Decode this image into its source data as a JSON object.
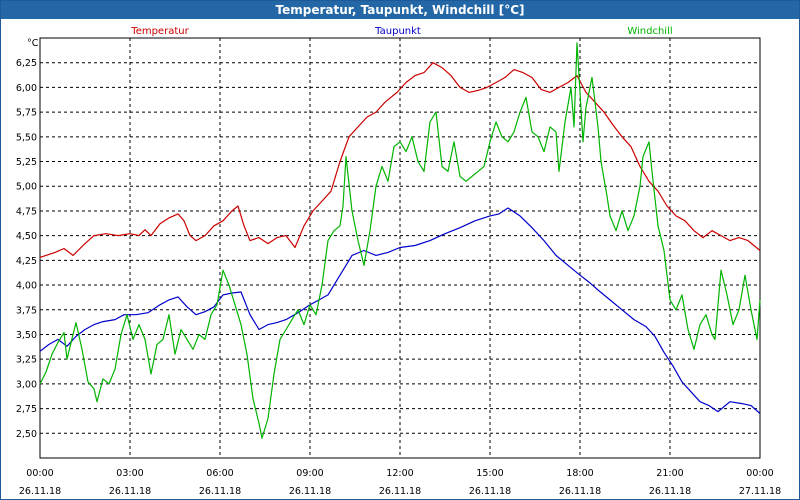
{
  "window": {
    "title": "Temperatur, Taupunkt, Windchill [°C]"
  },
  "chart_data": {
    "type": "line",
    "title": "Temperatur, Taupunkt, Windchill [°C]",
    "ylabel": "°C",
    "xlabel": "",
    "ylim": [
      2.25,
      6.5
    ],
    "xlim": [
      0,
      24
    ],
    "grid": true,
    "legend_position": "top",
    "y_ticks": [
      "2,50",
      "2,75",
      "3,00",
      "3,25",
      "3,50",
      "3,75",
      "4,00",
      "4,25",
      "4,50",
      "4,75",
      "5,00",
      "5,25",
      "5,50",
      "5,75",
      "6,00",
      "6,25"
    ],
    "y_tick_values": [
      2.5,
      2.75,
      3.0,
      3.25,
      3.5,
      3.75,
      4.0,
      4.25,
      4.5,
      4.75,
      5.0,
      5.25,
      5.5,
      5.75,
      6.0,
      6.25
    ],
    "x_tick_values": [
      0,
      3,
      6,
      9,
      12,
      15,
      18,
      21,
      24
    ],
    "x_ticks": [
      {
        "time": "00:00",
        "date": "26.11.18"
      },
      {
        "time": "03:00",
        "date": "26.11.18"
      },
      {
        "time": "06:00",
        "date": "26.11.18"
      },
      {
        "time": "09:00",
        "date": "26.11.18"
      },
      {
        "time": "12:00",
        "date": "26.11.18"
      },
      {
        "time": "15:00",
        "date": "26.11.18"
      },
      {
        "time": "18:00",
        "date": "26.11.18"
      },
      {
        "time": "21:00",
        "date": "26.11.18"
      },
      {
        "time": "00:00",
        "date": "27.11.18"
      }
    ],
    "series": [
      {
        "name": "Temperatur",
        "color": "#cc0000",
        "points": [
          [
            0,
            4.28
          ],
          [
            0.5,
            4.33
          ],
          [
            0.8,
            4.37
          ],
          [
            1.1,
            4.3
          ],
          [
            1.5,
            4.42
          ],
          [
            1.8,
            4.5
          ],
          [
            2.2,
            4.52
          ],
          [
            2.6,
            4.5
          ],
          [
            3.0,
            4.52
          ],
          [
            3.3,
            4.5
          ],
          [
            3.5,
            4.56
          ],
          [
            3.7,
            4.5
          ],
          [
            4.0,
            4.62
          ],
          [
            4.3,
            4.68
          ],
          [
            4.6,
            4.72
          ],
          [
            4.8,
            4.65
          ],
          [
            5.0,
            4.5
          ],
          [
            5.2,
            4.45
          ],
          [
            5.5,
            4.5
          ],
          [
            5.8,
            4.6
          ],
          [
            6.1,
            4.65
          ],
          [
            6.4,
            4.75
          ],
          [
            6.6,
            4.8
          ],
          [
            6.8,
            4.6
          ],
          [
            7.0,
            4.45
          ],
          [
            7.3,
            4.48
          ],
          [
            7.6,
            4.42
          ],
          [
            7.9,
            4.48
          ],
          [
            8.2,
            4.5
          ],
          [
            8.5,
            4.38
          ],
          [
            8.8,
            4.6
          ],
          [
            9.1,
            4.75
          ],
          [
            9.4,
            4.85
          ],
          [
            9.7,
            4.95
          ],
          [
            10.0,
            5.25
          ],
          [
            10.3,
            5.5
          ],
          [
            10.6,
            5.6
          ],
          [
            10.9,
            5.7
          ],
          [
            11.2,
            5.75
          ],
          [
            11.5,
            5.85
          ],
          [
            11.9,
            5.95
          ],
          [
            12.2,
            6.05
          ],
          [
            12.5,
            6.12
          ],
          [
            12.8,
            6.15
          ],
          [
            13.1,
            6.25
          ],
          [
            13.4,
            6.2
          ],
          [
            13.7,
            6.12
          ],
          [
            14.0,
            6.0
          ],
          [
            14.3,
            5.95
          ],
          [
            14.6,
            5.97
          ],
          [
            14.9,
            6.0
          ],
          [
            15.2,
            6.05
          ],
          [
            15.5,
            6.1
          ],
          [
            15.8,
            6.18
          ],
          [
            16.1,
            6.15
          ],
          [
            16.4,
            6.1
          ],
          [
            16.7,
            5.98
          ],
          [
            17.0,
            5.95
          ],
          [
            17.3,
            6.0
          ],
          [
            17.6,
            6.05
          ],
          [
            17.9,
            6.12
          ],
          [
            18.2,
            5.95
          ],
          [
            18.5,
            5.85
          ],
          [
            18.8,
            5.75
          ],
          [
            19.1,
            5.62
          ],
          [
            19.4,
            5.5
          ],
          [
            19.7,
            5.4
          ],
          [
            20.0,
            5.2
          ],
          [
            20.3,
            5.05
          ],
          [
            20.6,
            4.95
          ],
          [
            20.9,
            4.8
          ],
          [
            21.2,
            4.7
          ],
          [
            21.5,
            4.65
          ],
          [
            21.8,
            4.55
          ],
          [
            22.1,
            4.48
          ],
          [
            22.4,
            4.55
          ],
          [
            22.7,
            4.5
          ],
          [
            23.0,
            4.45
          ],
          [
            23.3,
            4.48
          ],
          [
            23.6,
            4.45
          ],
          [
            24.0,
            4.35
          ]
        ]
      },
      {
        "name": "Taupunkt",
        "color": "#0000cc",
        "points": [
          [
            0,
            3.33
          ],
          [
            0.3,
            3.4
          ],
          [
            0.6,
            3.45
          ],
          [
            0.9,
            3.38
          ],
          [
            1.2,
            3.48
          ],
          [
            1.5,
            3.55
          ],
          [
            1.8,
            3.6
          ],
          [
            2.1,
            3.63
          ],
          [
            2.5,
            3.65
          ],
          [
            2.8,
            3.7
          ],
          [
            3.2,
            3.7
          ],
          [
            3.6,
            3.72
          ],
          [
            4.0,
            3.8
          ],
          [
            4.3,
            3.85
          ],
          [
            4.6,
            3.88
          ],
          [
            4.9,
            3.78
          ],
          [
            5.2,
            3.7
          ],
          [
            5.5,
            3.73
          ],
          [
            5.8,
            3.78
          ],
          [
            6.1,
            3.9
          ],
          [
            6.4,
            3.92
          ],
          [
            6.7,
            3.93
          ],
          [
            7.0,
            3.7
          ],
          [
            7.3,
            3.55
          ],
          [
            7.6,
            3.6
          ],
          [
            7.9,
            3.62
          ],
          [
            8.2,
            3.65
          ],
          [
            8.6,
            3.72
          ],
          [
            9.0,
            3.8
          ],
          [
            9.3,
            3.85
          ],
          [
            9.6,
            3.9
          ],
          [
            10.0,
            4.1
          ],
          [
            10.4,
            4.3
          ],
          [
            10.8,
            4.35
          ],
          [
            11.2,
            4.3
          ],
          [
            11.6,
            4.33
          ],
          [
            12.0,
            4.38
          ],
          [
            12.5,
            4.4
          ],
          [
            13.0,
            4.45
          ],
          [
            13.5,
            4.52
          ],
          [
            14.0,
            4.58
          ],
          [
            14.5,
            4.65
          ],
          [
            15.0,
            4.7
          ],
          [
            15.3,
            4.72
          ],
          [
            15.6,
            4.78
          ],
          [
            16.0,
            4.7
          ],
          [
            16.4,
            4.58
          ],
          [
            16.8,
            4.45
          ],
          [
            17.2,
            4.3
          ],
          [
            17.6,
            4.2
          ],
          [
            18.0,
            4.1
          ],
          [
            18.3,
            4.03
          ],
          [
            18.6,
            3.95
          ],
          [
            19.0,
            3.85
          ],
          [
            19.4,
            3.75
          ],
          [
            19.8,
            3.65
          ],
          [
            20.2,
            3.58
          ],
          [
            20.5,
            3.48
          ],
          [
            20.8,
            3.32
          ],
          [
            21.1,
            3.18
          ],
          [
            21.4,
            3.02
          ],
          [
            21.7,
            2.92
          ],
          [
            22.0,
            2.82
          ],
          [
            22.3,
            2.78
          ],
          [
            22.6,
            2.72
          ],
          [
            23.0,
            2.82
          ],
          [
            23.4,
            2.8
          ],
          [
            23.7,
            2.78
          ],
          [
            24.0,
            2.7
          ]
        ]
      },
      {
        "name": "Windchill",
        "color": "#00b400",
        "points": [
          [
            0,
            3.0
          ],
          [
            0.2,
            3.12
          ],
          [
            0.4,
            3.3
          ],
          [
            0.6,
            3.42
          ],
          [
            0.8,
            3.52
          ],
          [
            0.9,
            3.25
          ],
          [
            1.1,
            3.5
          ],
          [
            1.2,
            3.62
          ],
          [
            1.4,
            3.35
          ],
          [
            1.6,
            3.02
          ],
          [
            1.8,
            2.95
          ],
          [
            1.9,
            2.82
          ],
          [
            2.1,
            3.05
          ],
          [
            2.3,
            3.0
          ],
          [
            2.5,
            3.15
          ],
          [
            2.7,
            3.5
          ],
          [
            2.9,
            3.7
          ],
          [
            3.1,
            3.45
          ],
          [
            3.3,
            3.6
          ],
          [
            3.5,
            3.45
          ],
          [
            3.7,
            3.1
          ],
          [
            3.9,
            3.4
          ],
          [
            4.1,
            3.45
          ],
          [
            4.3,
            3.7
          ],
          [
            4.5,
            3.3
          ],
          [
            4.7,
            3.55
          ],
          [
            4.9,
            3.45
          ],
          [
            5.1,
            3.35
          ],
          [
            5.3,
            3.5
          ],
          [
            5.5,
            3.45
          ],
          [
            5.7,
            3.7
          ],
          [
            5.9,
            3.8
          ],
          [
            6.1,
            4.15
          ],
          [
            6.3,
            4.0
          ],
          [
            6.5,
            3.8
          ],
          [
            6.7,
            3.6
          ],
          [
            6.9,
            3.3
          ],
          [
            7.1,
            2.85
          ],
          [
            7.3,
            2.6
          ],
          [
            7.4,
            2.45
          ],
          [
            7.6,
            2.65
          ],
          [
            7.8,
            3.1
          ],
          [
            8.0,
            3.45
          ],
          [
            8.2,
            3.55
          ],
          [
            8.4,
            3.65
          ],
          [
            8.6,
            3.75
          ],
          [
            8.8,
            3.6
          ],
          [
            9.0,
            3.8
          ],
          [
            9.2,
            3.7
          ],
          [
            9.4,
            4.0
          ],
          [
            9.6,
            4.45
          ],
          [
            9.8,
            4.55
          ],
          [
            10.0,
            4.6
          ],
          [
            10.1,
            4.8
          ],
          [
            10.2,
            5.3
          ],
          [
            10.4,
            4.75
          ],
          [
            10.6,
            4.45
          ],
          [
            10.8,
            4.2
          ],
          [
            11.0,
            4.55
          ],
          [
            11.2,
            5.0
          ],
          [
            11.4,
            5.2
          ],
          [
            11.6,
            5.05
          ],
          [
            11.8,
            5.4
          ],
          [
            12.0,
            5.45
          ],
          [
            12.2,
            5.35
          ],
          [
            12.4,
            5.5
          ],
          [
            12.6,
            5.25
          ],
          [
            12.8,
            5.15
          ],
          [
            13.0,
            5.65
          ],
          [
            13.2,
            5.75
          ],
          [
            13.4,
            5.2
          ],
          [
            13.6,
            5.15
          ],
          [
            13.8,
            5.45
          ],
          [
            14.0,
            5.1
          ],
          [
            14.2,
            5.05
          ],
          [
            14.4,
            5.1
          ],
          [
            14.6,
            5.15
          ],
          [
            14.8,
            5.2
          ],
          [
            15.0,
            5.45
          ],
          [
            15.2,
            5.65
          ],
          [
            15.4,
            5.5
          ],
          [
            15.6,
            5.45
          ],
          [
            15.8,
            5.55
          ],
          [
            16.0,
            5.75
          ],
          [
            16.2,
            5.9
          ],
          [
            16.4,
            5.55
          ],
          [
            16.6,
            5.5
          ],
          [
            16.8,
            5.35
          ],
          [
            17.0,
            5.6
          ],
          [
            17.2,
            5.55
          ],
          [
            17.3,
            5.15
          ],
          [
            17.5,
            5.65
          ],
          [
            17.7,
            6.0
          ],
          [
            17.8,
            5.6
          ],
          [
            17.9,
            6.45
          ],
          [
            18.0,
            5.95
          ],
          [
            18.1,
            5.45
          ],
          [
            18.2,
            5.8
          ],
          [
            18.4,
            6.1
          ],
          [
            18.6,
            5.6
          ],
          [
            18.7,
            5.25
          ],
          [
            18.9,
            4.9
          ],
          [
            19.0,
            4.7
          ],
          [
            19.2,
            4.55
          ],
          [
            19.4,
            4.75
          ],
          [
            19.6,
            4.55
          ],
          [
            19.8,
            4.7
          ],
          [
            20.0,
            5.0
          ],
          [
            20.1,
            5.3
          ],
          [
            20.3,
            5.45
          ],
          [
            20.4,
            5.15
          ],
          [
            20.6,
            4.6
          ],
          [
            20.8,
            4.35
          ],
          [
            21.0,
            3.85
          ],
          [
            21.2,
            3.75
          ],
          [
            21.4,
            3.9
          ],
          [
            21.6,
            3.55
          ],
          [
            21.8,
            3.35
          ],
          [
            22.0,
            3.6
          ],
          [
            22.2,
            3.7
          ],
          [
            22.4,
            3.5
          ],
          [
            22.5,
            3.45
          ],
          [
            22.7,
            4.15
          ],
          [
            22.9,
            3.9
          ],
          [
            23.1,
            3.6
          ],
          [
            23.3,
            3.75
          ],
          [
            23.5,
            4.1
          ],
          [
            23.7,
            3.75
          ],
          [
            23.9,
            3.45
          ],
          [
            24.0,
            3.85
          ]
        ]
      }
    ]
  }
}
